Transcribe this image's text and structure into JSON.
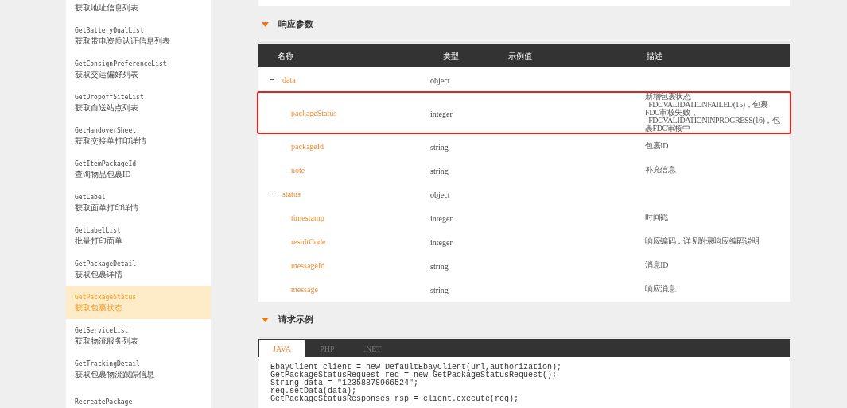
{
  "sidebar": {
    "items": [
      {
        "name": "获取地址信息列表",
        "selected": false
      },
      {
        "api": "GetBatteryQualList",
        "name": "获取带电资质认证信息列表",
        "selected": false
      },
      {
        "api": "GetConsignPreferenceList",
        "name": "获取交运偏好列表",
        "selected": false
      },
      {
        "api": "GetDropoffSiteList",
        "name": "获取自送站点列表",
        "selected": false
      },
      {
        "api": "GetHandoverSheet",
        "name": "获取交接单打印详情",
        "selected": false
      },
      {
        "api": "GetItemPackageId",
        "name": "查询物品包裹ID",
        "selected": false
      },
      {
        "api": "GetLabel",
        "name": "获取面单打印详情",
        "selected": false
      },
      {
        "api": "GetLabelList",
        "name": "批量打印面单",
        "selected": false
      },
      {
        "api": "GetPackageDetail",
        "name": "获取包裹详情",
        "selected": false
      },
      {
        "api": "GetPackageStatus",
        "name": "获取包裹状态",
        "selected": true
      },
      {
        "api": "GetServiceList",
        "name": "获取物流服务列表",
        "selected": false
      },
      {
        "api": "GetTrackingDetail",
        "name": "获取包裹物流跟踪信息",
        "selected": false
      },
      {
        "api": "RecreatePackage",
        "selected": false
      }
    ]
  },
  "response_section": {
    "title": "响应参数",
    "table": {
      "columns": [
        "名称",
        "类型",
        "示例值",
        "描述"
      ],
      "rows": [
        {
          "name": "data",
          "type": "object",
          "expanded": true,
          "highlighted": false,
          "children": [
            {
              "name": "packageStatus",
              "type": "integer",
              "description": "新增包裹状态\n  FDCVALIDATIONFAILED(15)，包裹FDC审核失败，\n  FDCVALIDATIONINPROGRESS(16)，包裹FDC审核中",
              "highlighted": true
            },
            {
              "name": "packageId",
              "type": "string",
              "description": "包裹ID",
              "highlighted": false
            },
            {
              "name": "note",
              "type": "string",
              "description": "补充信息",
              "highlighted": false
            }
          ]
        },
        {
          "name": "status",
          "type": "object",
          "expanded": true,
          "highlighted": false,
          "children": [
            {
              "name": "timestamp",
              "type": "integer",
              "description": "时间戳",
              "highlighted": false
            },
            {
              "name": "resultCode",
              "type": "integer",
              "description": "响应编码，详见附录响应编码说明",
              "highlighted": false
            },
            {
              "name": "messageId",
              "type": "string",
              "description": "消息ID",
              "highlighted": false
            },
            {
              "name": "message",
              "type": "string",
              "description": "响应消息",
              "highlighted": false
            }
          ]
        }
      ]
    }
  },
  "request_section": {
    "title": "请求示例",
    "tabs": [
      {
        "label": "JAVA",
        "selected": true
      },
      {
        "label": "PHP",
        "selected": false
      },
      {
        "label": ".NET",
        "selected": false
      }
    ],
    "code": "EbayClient client = new DefaultEbayClient(url,authorization);\nGetPackageStatusRequest req = new GetPackageStatusRequest();\nString data = \"12358878966524\";\nreq.setData(data);\nGetPackageStatusResponses rsp = client.execute(req);"
  }
}
